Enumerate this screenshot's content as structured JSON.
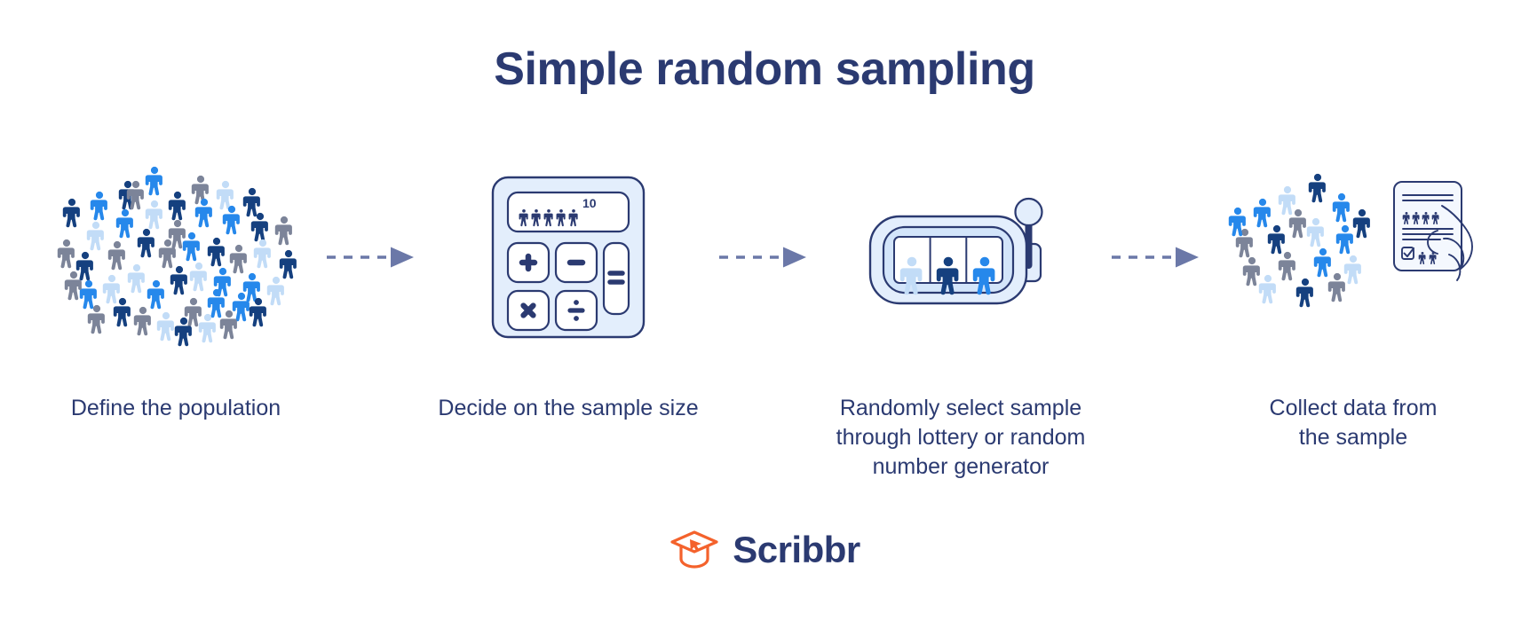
{
  "title": "Simple random sampling",
  "brand": {
    "name": "Scribbr",
    "logo_icon": "graduation-cap-cursor-icon",
    "logo_color": "#f4622c",
    "text_color": "#2b3a71"
  },
  "colors": {
    "navy": "#2b3a71",
    "person_bright_blue": "#2688eb",
    "person_navy": "#15407f",
    "person_gray": "#7c8499",
    "person_light_blue": "#c2dcf7",
    "arrow": "#6b78a8",
    "panel_fill": "#e3eefc",
    "panel_stroke": "#2b3a71"
  },
  "steps": [
    {
      "index": 1,
      "caption": "Define the population",
      "caption_lines": [
        "Define the population"
      ],
      "art": "population-crowd",
      "person_count": 48
    },
    {
      "index": 2,
      "caption": "Decide on the sample size",
      "caption_lines": [
        "Decide on the sample size"
      ],
      "art": "calculator",
      "calculator": {
        "display_people": 5,
        "display_superscript": "10",
        "keys": [
          "+",
          "−",
          "×",
          "÷",
          "="
        ]
      }
    },
    {
      "index": 3,
      "caption": "Randomly select sample through lottery or random number generator",
      "caption_lines": [
        "Randomly select sample",
        "through lottery or random",
        "number generator"
      ],
      "art": "slot-machine",
      "slot_machine": {
        "reels": [
          "light-blue-person",
          "navy-person",
          "bright-blue-person"
        ],
        "has_lever": true
      }
    },
    {
      "index": 4,
      "caption": "Collect data from the sample",
      "caption_lines": [
        "Collect data from",
        "the sample"
      ],
      "art": "sample-crowd-with-survey",
      "survey": {
        "text_lines": 5,
        "people_row": 4,
        "checkbox_people": 2,
        "has_hand": true
      }
    }
  ],
  "connectors": [
    {
      "from": 1,
      "to": 2,
      "style": "dashed-arrow"
    },
    {
      "from": 2,
      "to": 3,
      "style": "dashed-arrow"
    },
    {
      "from": 3,
      "to": 4,
      "style": "dashed-arrow"
    }
  ]
}
